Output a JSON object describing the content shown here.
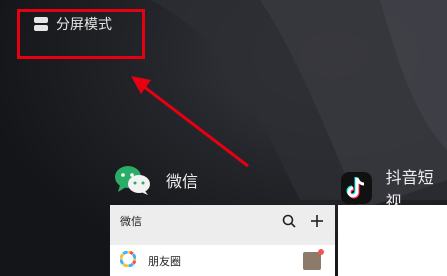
{
  "split_screen": {
    "label": "分屏模式",
    "icon": "split-screen-icon"
  },
  "annotation": {
    "highlight_color": "#e60012",
    "arrow_color": "#e60012"
  },
  "apps": {
    "wechat": {
      "name": "微信",
      "icon": "wechat-icon",
      "brand_color": "#2aae67"
    },
    "douyin": {
      "name": "抖音短视",
      "icon": "douyin-icon"
    }
  },
  "wechat_window": {
    "title": "微信",
    "search_icon": "search-icon",
    "add_icon": "plus-icon",
    "moments": {
      "label": "朋友圈",
      "icon": "moments-icon",
      "badge_color": "#fa5151"
    }
  }
}
